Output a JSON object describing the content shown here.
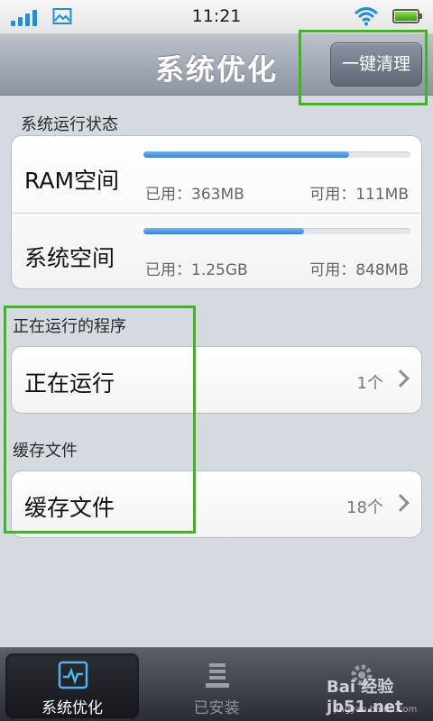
{
  "status_bar": {
    "time": "11:21",
    "icons": [
      "signal-icon",
      "image-icon",
      "wifi-icon",
      "battery-icon"
    ],
    "accent": "#1e90d8"
  },
  "header": {
    "title": "系统优化",
    "clean_button": "一键清理"
  },
  "system_status": {
    "section_label": "系统运行状态",
    "rows": [
      {
        "label": "RAM空间",
        "used": "已用：363MB",
        "free": "可用：111MB",
        "used_fraction": 0.77
      },
      {
        "label": "系统空间",
        "used": "已用：1.25GB",
        "free": "可用：848MB",
        "used_fraction": 0.6
      }
    ]
  },
  "running": {
    "section_label": "正在运行的程序",
    "row_label": "正在运行",
    "count": "1个"
  },
  "cache": {
    "section_label": "缓存文件",
    "row_label": "缓存文件",
    "count": "18个"
  },
  "tabs": [
    {
      "label": "系统优化",
      "icon": "pulse-chart-icon",
      "active": true
    },
    {
      "label": "已安装",
      "icon": "stack-icon",
      "active": false
    },
    {
      "label": "",
      "icon": "gear-icon",
      "active": false
    }
  ],
  "watermark": {
    "text": "Bai 经验 jb51.net",
    "site": "jingyan.baidu.com"
  },
  "colors": {
    "highlight_box": "#3cb81e",
    "progress": "#2f86d9",
    "header": "#8c94a2"
  }
}
